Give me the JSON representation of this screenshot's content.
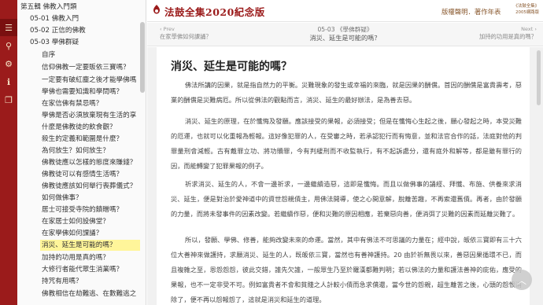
{
  "rail": {
    "items": [
      {
        "icon": "menu-icon",
        "glyph": "☰"
      },
      {
        "icon": "search-icon",
        "glyph": "⚲"
      },
      {
        "icon": "gear-icon",
        "glyph": "⚙"
      },
      {
        "icon": "info-icon",
        "glyph": "ℹ"
      },
      {
        "icon": "copy-icon",
        "glyph": "❐"
      }
    ]
  },
  "tree": {
    "rows": [
      {
        "label": "第五輯 佛教入門類",
        "level": 0
      },
      {
        "label": "05-01 佛教入門",
        "level": 1
      },
      {
        "label": "05-02 正信的佛教",
        "level": 1
      },
      {
        "label": "05-03 學佛群疑",
        "level": 1,
        "expanded": true
      },
      {
        "label": "自序",
        "level": 2
      },
      {
        "label": "信仰佛教一定要販依三寶嗎？",
        "level": 2
      },
      {
        "label": "一定要有破紅塵之後才能學佛嗎",
        "level": 2
      },
      {
        "label": "學佛也需要知識和學問嗎？",
        "level": 2
      },
      {
        "label": "在家信佛有禁忌嗎？",
        "level": 2
      },
      {
        "label": "學佛是否必須放棄現有生活的享",
        "level": 2
      },
      {
        "label": "什麼是佛教徒的飲食觀？",
        "level": 2
      },
      {
        "label": "殺生的定義和範圍是什麼？",
        "level": 2
      },
      {
        "label": "為何放生？如何放生？",
        "level": 2
      },
      {
        "label": "佛教徒應以怎樣的態度來賺錢？",
        "level": 2
      },
      {
        "label": "佛教徒可以有感情生活嗎？",
        "level": 2
      },
      {
        "label": "佛教徒應該如何舉行喪葬儀式？",
        "level": 2
      },
      {
        "label": "如何做佛事？",
        "level": 2
      },
      {
        "label": "居士可接受寺院的饋贈嗎？",
        "level": 2
      },
      {
        "label": "在家居士如何設佛堂？",
        "level": 2
      },
      {
        "label": "在家學佛如何課誦？",
        "level": 2
      },
      {
        "label": "消災、延生是可能的嗎？",
        "level": 2,
        "selected": true
      },
      {
        "label": "加持的功用是真的嗎？",
        "level": 2
      },
      {
        "label": "大修行者能代眾生消業嗎？",
        "level": 2
      },
      {
        "label": "持咒有用嗎？",
        "level": 2
      },
      {
        "label": "佛教相信在劫難逃、在數難逃之",
        "level": 2
      }
    ]
  },
  "header": {
    "brand": "法鼓全集2020紀念版",
    "copyright_link": "版權聲明．著作年表",
    "edition_line1": "《法鼓全集》",
    "edition_line2": "2005網路版"
  },
  "navbar": {
    "prev_label": "Prev",
    "prev_title": "在家學佛如何課誦？",
    "crumb": "05-03 《學佛群疑》",
    "crumb_sub": "消災、延生是可能的嗎？",
    "next_label": "Next",
    "next_title": "加持的功用是真的嗎？"
  },
  "article": {
    "title": "消災、延生是可能的嗎？",
    "paragraphs": [
      "佛法所講的因果，就是指自然力的平衡。災難現象的發生或幸福的來臨，就是因果的酬償。首因的酬償是富貴壽考，惡業的酬償是災難病厄。所以從佛法的觀點而言，消災、延生的最好辦法，是為善去惡。",
      "消災、延生的原理，在於懺悔及發願。應該接受的果報，必須接受；但是在懺悔心生起之後，願心發起之時，本受災難的厄運，也就可以化重報為輕報。這好像犯罪的人，在受審之時，若承認犯行而有悔意，並和法官合作的話，法庭對他的判罪量刑會減輕。古有戴罪立功、將功贖罪，今有判緩刑而不收監執行，有不起訴處分，還有庭外和解等，都是雖有罪行的因，而能轉變了犯罪果報的例子。",
      "祈求消災、延生的人，不會一邊祈求，一邊繼續造惡，這即是懺悔。而且以做佛事的誦經、拜懺、布施、供養來求消災、延生，便是對治於愛神道中的資世怨親債主，用佛法開導，使之心開意解，脫離苦趣，不再索還舊債。再者，由於發願的力量，而將未發事件的因素改變。若繼續作惡，便和災難的原因相應，若棄惡向善，便消弭了災難的因素而延離災難了。",
      "所以，發願、學佛、修善，能夠改變未來的命運。當然，其中有佛法不可思議的力量在；經中說，皈依三寶即有三十六位大善神來做護持，求願消災、延生的人，既皈依三寶，當然也有善神護持。20 由於祈無畏以來，善惡因果循環不已，而且複雜之至，恩怨怨怨，彼此交錯，誰先欠誰，一般眾生乃至於羅漢都難判明；若以佛法的力量和護法善神的庇佑，應受的果報，也不一定非受不可。例如富貴者不會和貧賤之人計較小債而急求償還，當今世的怨親，超生離苦之後，心頭的怨恨消除了，便不再以怨報怨了，這就是消災和延生的道理。"
    ]
  }
}
